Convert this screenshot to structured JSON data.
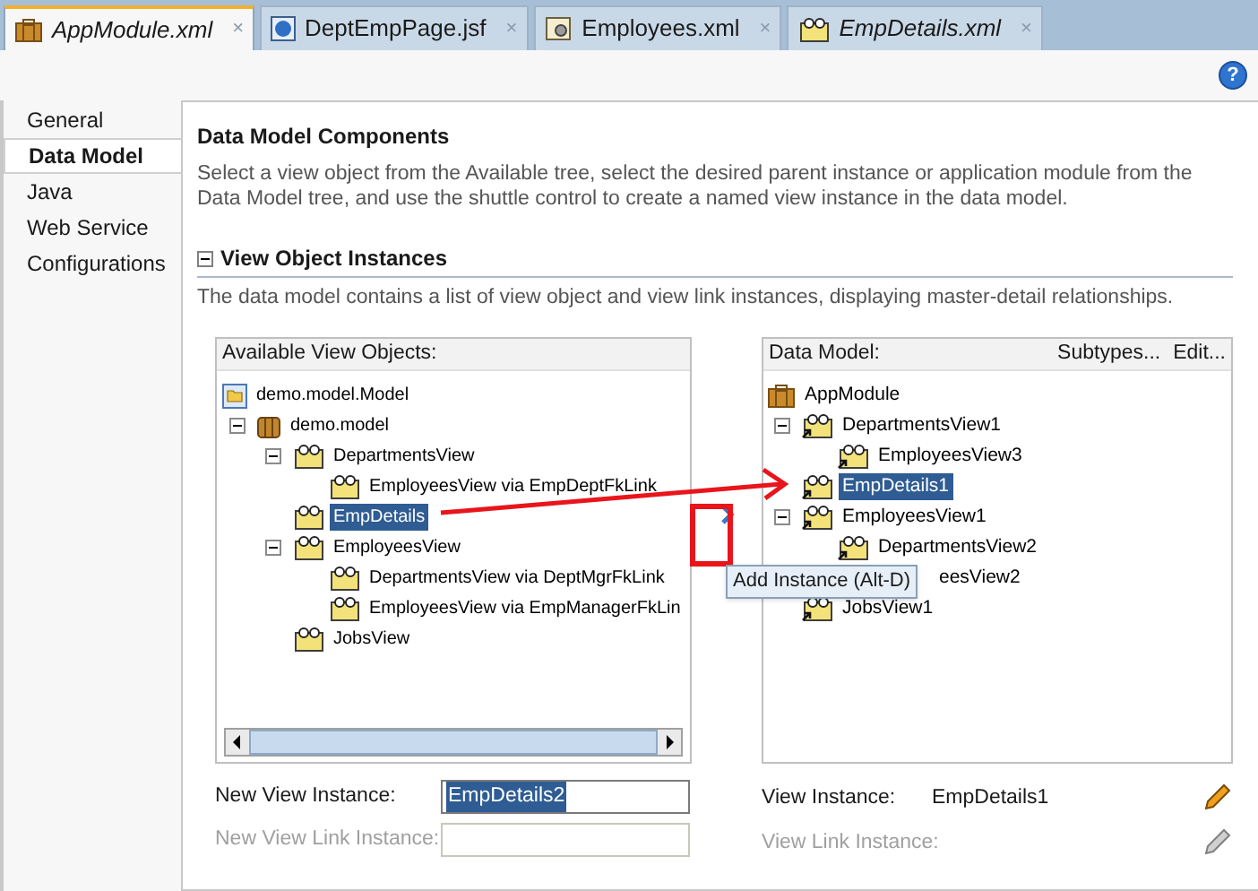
{
  "tabs": [
    {
      "label": "AppModule.xml",
      "kind": "app-module",
      "selected": true,
      "modified": true,
      "close": "×"
    },
    {
      "label": "DeptEmpPage.jsf",
      "kind": "page",
      "selected": false,
      "modified": false,
      "close": "×"
    },
    {
      "label": "Employees.xml",
      "kind": "entity",
      "selected": false,
      "modified": false,
      "close": "×"
    },
    {
      "label": "EmpDetails.xml",
      "kind": "view",
      "selected": false,
      "modified": true,
      "close": "×"
    }
  ],
  "help": "?",
  "nav": [
    {
      "label": "General",
      "selected": false
    },
    {
      "label": "Data Model",
      "selected": true
    },
    {
      "label": "Java",
      "selected": false
    },
    {
      "label": "Web Service",
      "selected": false
    },
    {
      "label": "Configurations",
      "selected": false
    }
  ],
  "title": "Data Model Components",
  "intro": "Select a view object from the Available tree, select the desired parent instance or application module from the Data Model tree, and use the shuttle control to create a named view instance in the data model.",
  "instances": {
    "title": "View Object Instances",
    "expanded": true,
    "description": "The data model contains a list of view object and view link instances, displaying master-detail relationships."
  },
  "available": {
    "header": "Available View Objects:",
    "tree": [
      {
        "label": "demo.model.Model",
        "kind": "folder",
        "selected": false,
        "children": [
          {
            "label": "demo.model",
            "kind": "package",
            "selected": false,
            "expanded": true,
            "children": [
              {
                "label": "DepartmentsView",
                "kind": "view",
                "selected": false,
                "expanded": true,
                "children": [
                  {
                    "label": "EmployeesView via EmpDeptFkLink",
                    "kind": "view",
                    "selected": false
                  }
                ]
              },
              {
                "label": "EmpDetails",
                "kind": "view",
                "selected": true
              },
              {
                "label": "EmployeesView",
                "kind": "view",
                "selected": false,
                "expanded": true,
                "children": [
                  {
                    "label": "DepartmentsView via DeptMgrFkLink",
                    "kind": "view",
                    "selected": false
                  },
                  {
                    "label": "EmployeesView via EmpManagerFkLin",
                    "kind": "view",
                    "selected": false
                  }
                ]
              },
              {
                "label": "JobsView",
                "kind": "view",
                "selected": false
              }
            ]
          }
        ]
      }
    ]
  },
  "shuttle": {
    "tooltip": "Add Instance (Alt-D)"
  },
  "data_model": {
    "header": "Data Model:",
    "actions": [
      "Subtypes...",
      "Edit..."
    ],
    "tree": [
      {
        "label": "AppModule",
        "kind": "app-module",
        "selected": false,
        "children": [
          {
            "label": "DepartmentsView1",
            "kind": "instance",
            "selected": false,
            "expanded": true,
            "children": [
              {
                "label": "EmployeesView3",
                "kind": "instance",
                "selected": false
              }
            ]
          },
          {
            "label": "EmpDetails1",
            "kind": "instance",
            "selected": true
          },
          {
            "label": "EmployeesView1",
            "kind": "instance",
            "selected": false,
            "expanded": true,
            "children": [
              {
                "label": "DepartmentsView2",
                "kind": "instance",
                "selected": false
              },
              {
                "label": "eesView2",
                "selected": false,
                "covered": true
              }
            ]
          },
          {
            "label": "JobsView1",
            "kind": "instance",
            "selected": false
          }
        ]
      }
    ]
  },
  "new_view_instance": {
    "label": "New View Instance:",
    "value": "EmpDetails2",
    "disabled": false
  },
  "new_view_link_instance": {
    "label": "New View Link Instance:",
    "disabled": true
  },
  "view_instance": {
    "label": "View Instance:",
    "value": "EmpDetails1",
    "disabled": false
  },
  "view_link_instance": {
    "label": "View Link Instance:",
    "disabled": true
  }
}
